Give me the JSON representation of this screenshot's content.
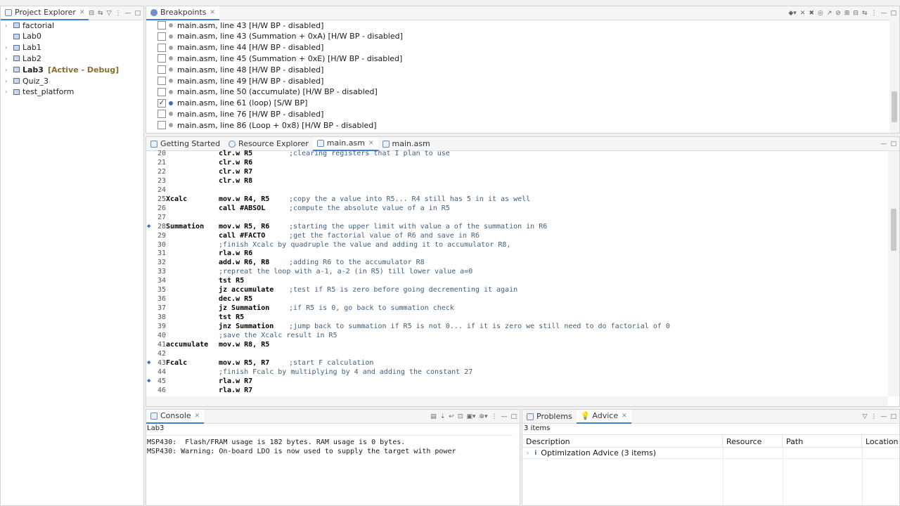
{
  "project_explorer": {
    "title": "Project Explorer",
    "items": [
      {
        "label": "factorial",
        "expandable": true
      },
      {
        "label": "Lab0",
        "expandable": false
      },
      {
        "label": "Lab1",
        "expandable": true
      },
      {
        "label": "Lab2",
        "expandable": true
      },
      {
        "label": "Lab3",
        "tag": "[Active - Debug]",
        "expandable": true
      },
      {
        "label": "Quiz_3",
        "expandable": true
      },
      {
        "label": "test_platform",
        "expandable": true
      }
    ]
  },
  "breakpoints": {
    "title": "Breakpoints",
    "items": [
      {
        "label": "main.asm, line 43 [H/W BP - disabled]",
        "checked": false
      },
      {
        "label": "main.asm, line 43 (Summation + 0xA)  [H/W BP - disabled]",
        "checked": false
      },
      {
        "label": "main.asm, line 44 [H/W BP - disabled]",
        "checked": false
      },
      {
        "label": "main.asm, line 45 (Summation + 0xE)  [H/W BP - disabled]",
        "checked": false
      },
      {
        "label": "main.asm, line 48 [H/W BP - disabled]",
        "checked": false
      },
      {
        "label": "main.asm, line 49 [H/W BP - disabled]",
        "checked": false
      },
      {
        "label": "main.asm, line 50 (accumulate)  [H/W BP - disabled]",
        "checked": false
      },
      {
        "label": "main.asm, line 61 (loop)  [S/W BP]",
        "checked": true
      },
      {
        "label": "main.asm, line 76 [H/W BP - disabled]",
        "checked": false
      },
      {
        "label": "main.asm, line 86 (Loop + 0x8)  [H/W BP - disabled]",
        "checked": false
      }
    ]
  },
  "editor": {
    "tabs": [
      "Getting Started",
      "Resource Explorer",
      "main.asm",
      "main.asm"
    ],
    "active_tab": 2,
    "lines": [
      {
        "n": "20",
        "label": "",
        "instr": "clr.w R5",
        "comment": ";clearing registers that I plan to use",
        "mark": false
      },
      {
        "n": "21",
        "label": "",
        "instr": "clr.w R6",
        "comment": "",
        "mark": false
      },
      {
        "n": "22",
        "label": "",
        "instr": "clr.w R7",
        "comment": "",
        "mark": false
      },
      {
        "n": "23",
        "label": "",
        "instr": "clr.w R8",
        "comment": "",
        "mark": false
      },
      {
        "n": "24",
        "label": "",
        "instr": "",
        "comment": "",
        "mark": false
      },
      {
        "n": "25",
        "label": "Xcalc",
        "instr": "mov.w R4, R5",
        "comment": ";copy the a value into R5... R4 still has 5 in it as well",
        "mark": false
      },
      {
        "n": "26",
        "label": "",
        "instr": "call #ABSOL",
        "comment": ";compute the absolute value of a in R5",
        "mark": false
      },
      {
        "n": "27",
        "label": "",
        "instr": "",
        "comment": "",
        "mark": false
      },
      {
        "n": "28",
        "label": "Summation",
        "instr": "mov.w R5, R6",
        "comment": ";starting the upper limit with value a of the summation in R6",
        "mark": true
      },
      {
        "n": "29",
        "label": "",
        "instr": "call #FACTO",
        "comment": ";get the factorial value of R6 and save in R6",
        "mark": false
      },
      {
        "n": "30",
        "label": "",
        "instr": "",
        "comment": ";finish Xcalc by quadruple the value and adding it to accumulator R8,",
        "mark": false
      },
      {
        "n": "31",
        "label": "",
        "instr": "rla.w R6",
        "comment": "",
        "mark": false
      },
      {
        "n": "32",
        "label": "",
        "instr": "add.w R6, R8",
        "comment": ";adding R6 to the accumulator R8",
        "mark": false
      },
      {
        "n": "33",
        "label": "",
        "instr": "",
        "comment": ";repreat the loop with a-1, a-2 (in R5) till lower value a=0",
        "mark": false
      },
      {
        "n": "34",
        "label": "",
        "instr": "tst R5",
        "comment": "",
        "mark": false
      },
      {
        "n": "35",
        "label": "",
        "instr": "jz accumulate",
        "comment": ";test if R5 is zero before going decrementing it again",
        "mark": false
      },
      {
        "n": "36",
        "label": "",
        "instr": "dec.w R5",
        "comment": "",
        "mark": false
      },
      {
        "n": "37",
        "label": "",
        "instr": "jz Summation",
        "comment": ";if R5 is 0, go back to summation check",
        "mark": false
      },
      {
        "n": "38",
        "label": "",
        "instr": "tst R5",
        "comment": "",
        "mark": false
      },
      {
        "n": "39",
        "label": "",
        "instr": "jnz Summation",
        "comment": ";jump back to summation if R5 is not 0... if it is zero we still need to do factorial of 0",
        "mark": false
      },
      {
        "n": "40",
        "label": "",
        "instr": "",
        "comment": ";save the Xcalc result in R5",
        "mark": false
      },
      {
        "n": "41",
        "label": "accumulate",
        "instr": "mov.w R8, R5",
        "comment": "",
        "mark": false
      },
      {
        "n": "42",
        "label": "",
        "instr": "",
        "comment": "",
        "mark": false
      },
      {
        "n": "43",
        "label": "Fcalc",
        "instr": "mov.w R5, R7",
        "comment": ";start F calculation",
        "mark": true
      },
      {
        "n": "44",
        "label": "",
        "instr": "",
        "comment": ";finish Fcalc by multiplying by 4 and adding the constant 27",
        "mark": false
      },
      {
        "n": "45",
        "label": "",
        "instr": "rla.w R7",
        "comment": "",
        "mark": true
      },
      {
        "n": "46",
        "label": "",
        "instr": "rla.w R7",
        "comment": "",
        "mark": false
      }
    ]
  },
  "console": {
    "title": "Console",
    "project": "Lab3",
    "lines": [
      "MSP430:  Flash/FRAM usage is 182 bytes. RAM usage is 0 bytes.",
      "MSP430: Warning: On-board LDO is now used to supply the target with power"
    ]
  },
  "problems": {
    "tabs": [
      "Problems",
      "Advice"
    ],
    "count": "3 items",
    "columns": [
      "Description",
      "Resource",
      "Path",
      "Location"
    ],
    "rows": [
      {
        "description": "Optimization Advice (3 items)"
      }
    ]
  }
}
